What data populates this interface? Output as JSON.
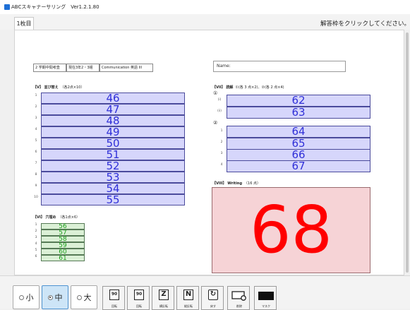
{
  "window": {
    "title": "ABCスキャナーサリング　Ver1.2.1.80"
  },
  "tabs": [
    {
      "label": "1枚目"
    }
  ],
  "hint_text": "解答枠をクリックしてください。",
  "header": {
    "exam_cells": [
      "2 学期中間考査",
      "現在3年2・3組",
      "Communication 英語 III"
    ],
    "name_label": "Name:"
  },
  "sections": {
    "v": {
      "title": "【V】 並び替え",
      "points": "（各2点×10）",
      "rows": [
        "1",
        "2",
        "3",
        "4",
        "5",
        "6",
        "7",
        "8",
        "9",
        "10"
      ],
      "answers": [
        "46",
        "47",
        "48",
        "49",
        "50",
        "51",
        "52",
        "53",
        "54",
        "55"
      ]
    },
    "vi": {
      "title": "【VI】 穴埋め",
      "points": "（各1点×6）",
      "rows": [
        "1",
        "2",
        "3",
        "4",
        "5",
        "6"
      ],
      "answers": [
        "56",
        "57",
        "58",
        "59",
        "60",
        "61"
      ]
    },
    "vii": {
      "title": "【VII】 読解",
      "points": "①(各 3 点×2)、②(各 2 点×4)",
      "part1": "①",
      "part2": "②",
      "sub_rows": [
        "(i)",
        "(ii)"
      ],
      "sub_answers": [
        "62",
        "63"
      ],
      "rows": [
        "1",
        "2",
        "3",
        "4"
      ],
      "answers": [
        "64",
        "65",
        "66",
        "67"
      ]
    },
    "viii": {
      "title": "【VIII】 Writing",
      "points": "（16 点）",
      "answer": "68"
    }
  },
  "toolbar": {
    "size_options": [
      {
        "label": "小",
        "selected": false
      },
      {
        "label": "中",
        "selected": true
      },
      {
        "label": "大",
        "selected": false
      }
    ],
    "buttons": [
      {
        "label": "回転",
        "icon": "rotate-left-icon",
        "glyph": "90"
      },
      {
        "label": "回転",
        "icon": "rotate-right-icon",
        "glyph": "90"
      },
      {
        "label": "横反転",
        "icon": "flip-horizontal-icon",
        "glyph": "Z"
      },
      {
        "label": "縦反転",
        "icon": "flip-vertical-icon",
        "glyph": "N"
      },
      {
        "label": "戻す",
        "icon": "undo-icon",
        "glyph": "↻"
      },
      {
        "label": "削除",
        "icon": "delete-icon",
        "glyph": ""
      },
      {
        "label": "マスク",
        "icon": "mask-icon",
        "glyph": ""
      }
    ]
  },
  "colors": {
    "answer_box_fill": "#d6d6fb",
    "answer_box_text": "#2f2fd8",
    "small_box_fill": "#dbf0d6",
    "small_box_text": "#1c9d1c",
    "writing_fill": "#f6d3d6",
    "writing_text": "#ff0000",
    "selected_size": "#cde5f7"
  }
}
